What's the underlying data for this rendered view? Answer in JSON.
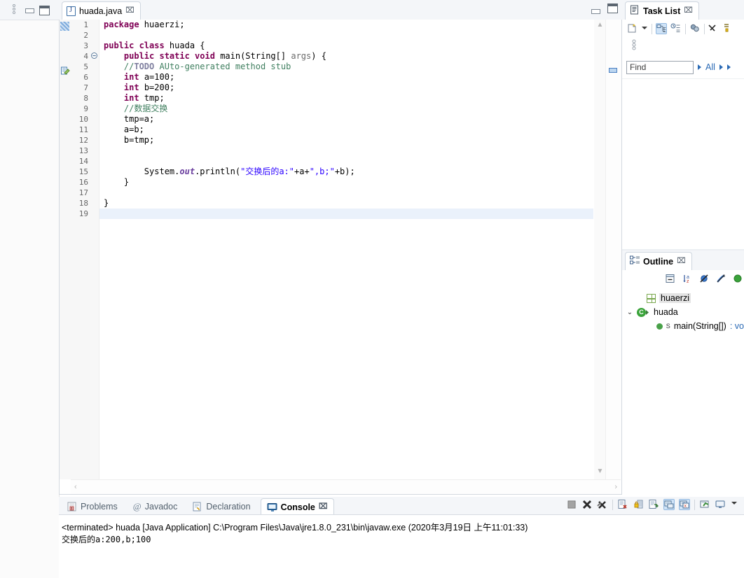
{
  "window": {
    "left_rail": {
      "restore_icon": "restore-icon",
      "minimize_icon": "minimize-icon",
      "maximize_icon": "maximize-icon"
    }
  },
  "editor": {
    "tab": {
      "label": "huada.java",
      "icon": "java-file-icon",
      "close": "⌧"
    },
    "minimize_icon": "minimize-icon",
    "maximize_icon": "maximize-icon",
    "line_numbers": [
      "1",
      "2",
      "3",
      "4",
      "5",
      "6",
      "7",
      "8",
      "9",
      "10",
      "11",
      "12",
      "13",
      "14",
      "15",
      "16",
      "17",
      "18",
      "19"
    ],
    "fold_marker_line": "4",
    "current_line": "19",
    "code": [
      {
        "n": "1",
        "segments": [
          {
            "t": "package ",
            "c": "kw"
          },
          {
            "t": "huaerzi;",
            "c": ""
          }
        ]
      },
      {
        "n": "2",
        "segments": [
          {
            "t": "",
            "c": ""
          }
        ]
      },
      {
        "n": "3",
        "segments": [
          {
            "t": "public class ",
            "c": "kw"
          },
          {
            "t": "huada {",
            "c": ""
          }
        ]
      },
      {
        "n": "4",
        "segments": [
          {
            "t": "    ",
            "c": ""
          },
          {
            "t": "public static void ",
            "c": "kw"
          },
          {
            "t": "main(String[] ",
            "c": ""
          },
          {
            "t": "args",
            "c": "arg"
          },
          {
            "t": ") {",
            "c": ""
          }
        ]
      },
      {
        "n": "5",
        "segments": [
          {
            "t": "    ",
            "c": ""
          },
          {
            "t": "//",
            "c": "cmt"
          },
          {
            "t": "TODO",
            "c": "todo"
          },
          {
            "t": " AUto-generated method stub",
            "c": "cmt"
          }
        ]
      },
      {
        "n": "6",
        "segments": [
          {
            "t": "    ",
            "c": ""
          },
          {
            "t": "int",
            "c": "kw"
          },
          {
            "t": " a=100;",
            "c": ""
          }
        ]
      },
      {
        "n": "7",
        "segments": [
          {
            "t": "    ",
            "c": ""
          },
          {
            "t": "int",
            "c": "kw"
          },
          {
            "t": " b=200;",
            "c": ""
          }
        ]
      },
      {
        "n": "8",
        "segments": [
          {
            "t": "    ",
            "c": ""
          },
          {
            "t": "int",
            "c": "kw"
          },
          {
            "t": " tmp;",
            "c": ""
          }
        ]
      },
      {
        "n": "9",
        "segments": [
          {
            "t": "    ",
            "c": ""
          },
          {
            "t": "//数据交换",
            "c": "cmt"
          }
        ]
      },
      {
        "n": "10",
        "segments": [
          {
            "t": "    tmp=a;",
            "c": ""
          }
        ]
      },
      {
        "n": "11",
        "segments": [
          {
            "t": "    a=b;",
            "c": ""
          }
        ]
      },
      {
        "n": "12",
        "segments": [
          {
            "t": "    b=tmp;",
            "c": ""
          }
        ]
      },
      {
        "n": "13",
        "segments": [
          {
            "t": "",
            "c": ""
          }
        ]
      },
      {
        "n": "14",
        "segments": [
          {
            "t": "",
            "c": ""
          }
        ]
      },
      {
        "n": "15",
        "segments": [
          {
            "t": "        System.",
            "c": ""
          },
          {
            "t": "out",
            "c": "fld"
          },
          {
            "t": ".println(",
            "c": ""
          },
          {
            "t": "\"交换后的a:\"",
            "c": "str"
          },
          {
            "t": "+a+",
            "c": ""
          },
          {
            "t": "\",b;\"",
            "c": "str"
          },
          {
            "t": "+b);",
            "c": ""
          }
        ]
      },
      {
        "n": "16",
        "segments": [
          {
            "t": "    }",
            "c": ""
          }
        ]
      },
      {
        "n": "17",
        "segments": [
          {
            "t": "",
            "c": ""
          }
        ]
      },
      {
        "n": "18",
        "segments": [
          {
            "t": "}",
            "c": ""
          }
        ]
      },
      {
        "n": "19",
        "segments": [
          {
            "t": "",
            "c": ""
          }
        ]
      }
    ],
    "scroll": {
      "up_arrow": "▲",
      "down_arrow": "▼",
      "left_arrow": "‹",
      "right_arrow": "›"
    }
  },
  "bottom_panel": {
    "tabs": [
      {
        "label": "Problems",
        "icon": "problems-icon",
        "active": false
      },
      {
        "label": "Javadoc",
        "icon": "javadoc-icon",
        "active": false
      },
      {
        "label": "Declaration",
        "icon": "declaration-icon",
        "active": false
      },
      {
        "label": "Console",
        "icon": "console-icon",
        "active": true
      }
    ],
    "close_glyph": "⌧",
    "toolbar_icons": [
      "terminate-all-icon",
      "remove-launch-icon",
      "remove-all-terminated-icon",
      "clear-console-icon",
      "scroll-lock-icon",
      "word-wrap-icon",
      "show-console-on-output-icon",
      "pin-console-icon",
      "open-console-icon",
      "display-selected-console-icon",
      "view-menu-icon"
    ],
    "console": {
      "header": "<terminated> huada [Java Application] C:\\Program Files\\Java\\jre1.8.0_231\\bin\\javaw.exe (2020年3月19日 上午11:01:33)",
      "output": "交换后的a:200,b;100"
    }
  },
  "task_list": {
    "title": "Task List",
    "icon": "task-list-icon",
    "close_glyph": "⌧",
    "toolbar_icons": [
      "new-task-icon",
      "new-task-dropdown-icon",
      "categorized-presentation-icon",
      "scheduled-presentation-icon",
      "focus-on-workweek-icon",
      "filter-completed-icon",
      "view-menu-icon"
    ],
    "row2_icon": "restore-maximize-icon",
    "find": {
      "placeholder": "Find",
      "value": ""
    },
    "all_label": "All",
    "arrow_glyph": "▸"
  },
  "outline": {
    "title": "Outline",
    "icon": "outline-icon",
    "close_glyph": "⌧",
    "toolbar_icons": [
      "collapse-all-icon",
      "sort-icon",
      "hide-fields-icon",
      "hide-static-icon",
      "hide-nonpublic-icon"
    ],
    "tree": [
      {
        "label": "huaerzi",
        "icon": "package-icon",
        "indent": 1,
        "selected": true,
        "expander": "",
        "returns": ""
      },
      {
        "label": "huada",
        "icon": "class-icon",
        "indent": 0,
        "selected": false,
        "expander": "⌄",
        "returns": ""
      },
      {
        "label": "main(String[])",
        "icon": "method-icon",
        "indent": 2,
        "selected": false,
        "expander": "",
        "returns": " : vo",
        "static_marker": "S"
      }
    ]
  },
  "colors": {
    "keyword": "#7f0055",
    "comment": "#3f7f5f",
    "string": "#2a00ff",
    "field": "#6a3e9e",
    "accent": "#2a6ab5",
    "tab_bar": "#f4f6f9",
    "current_line": "#eaf1fb"
  }
}
